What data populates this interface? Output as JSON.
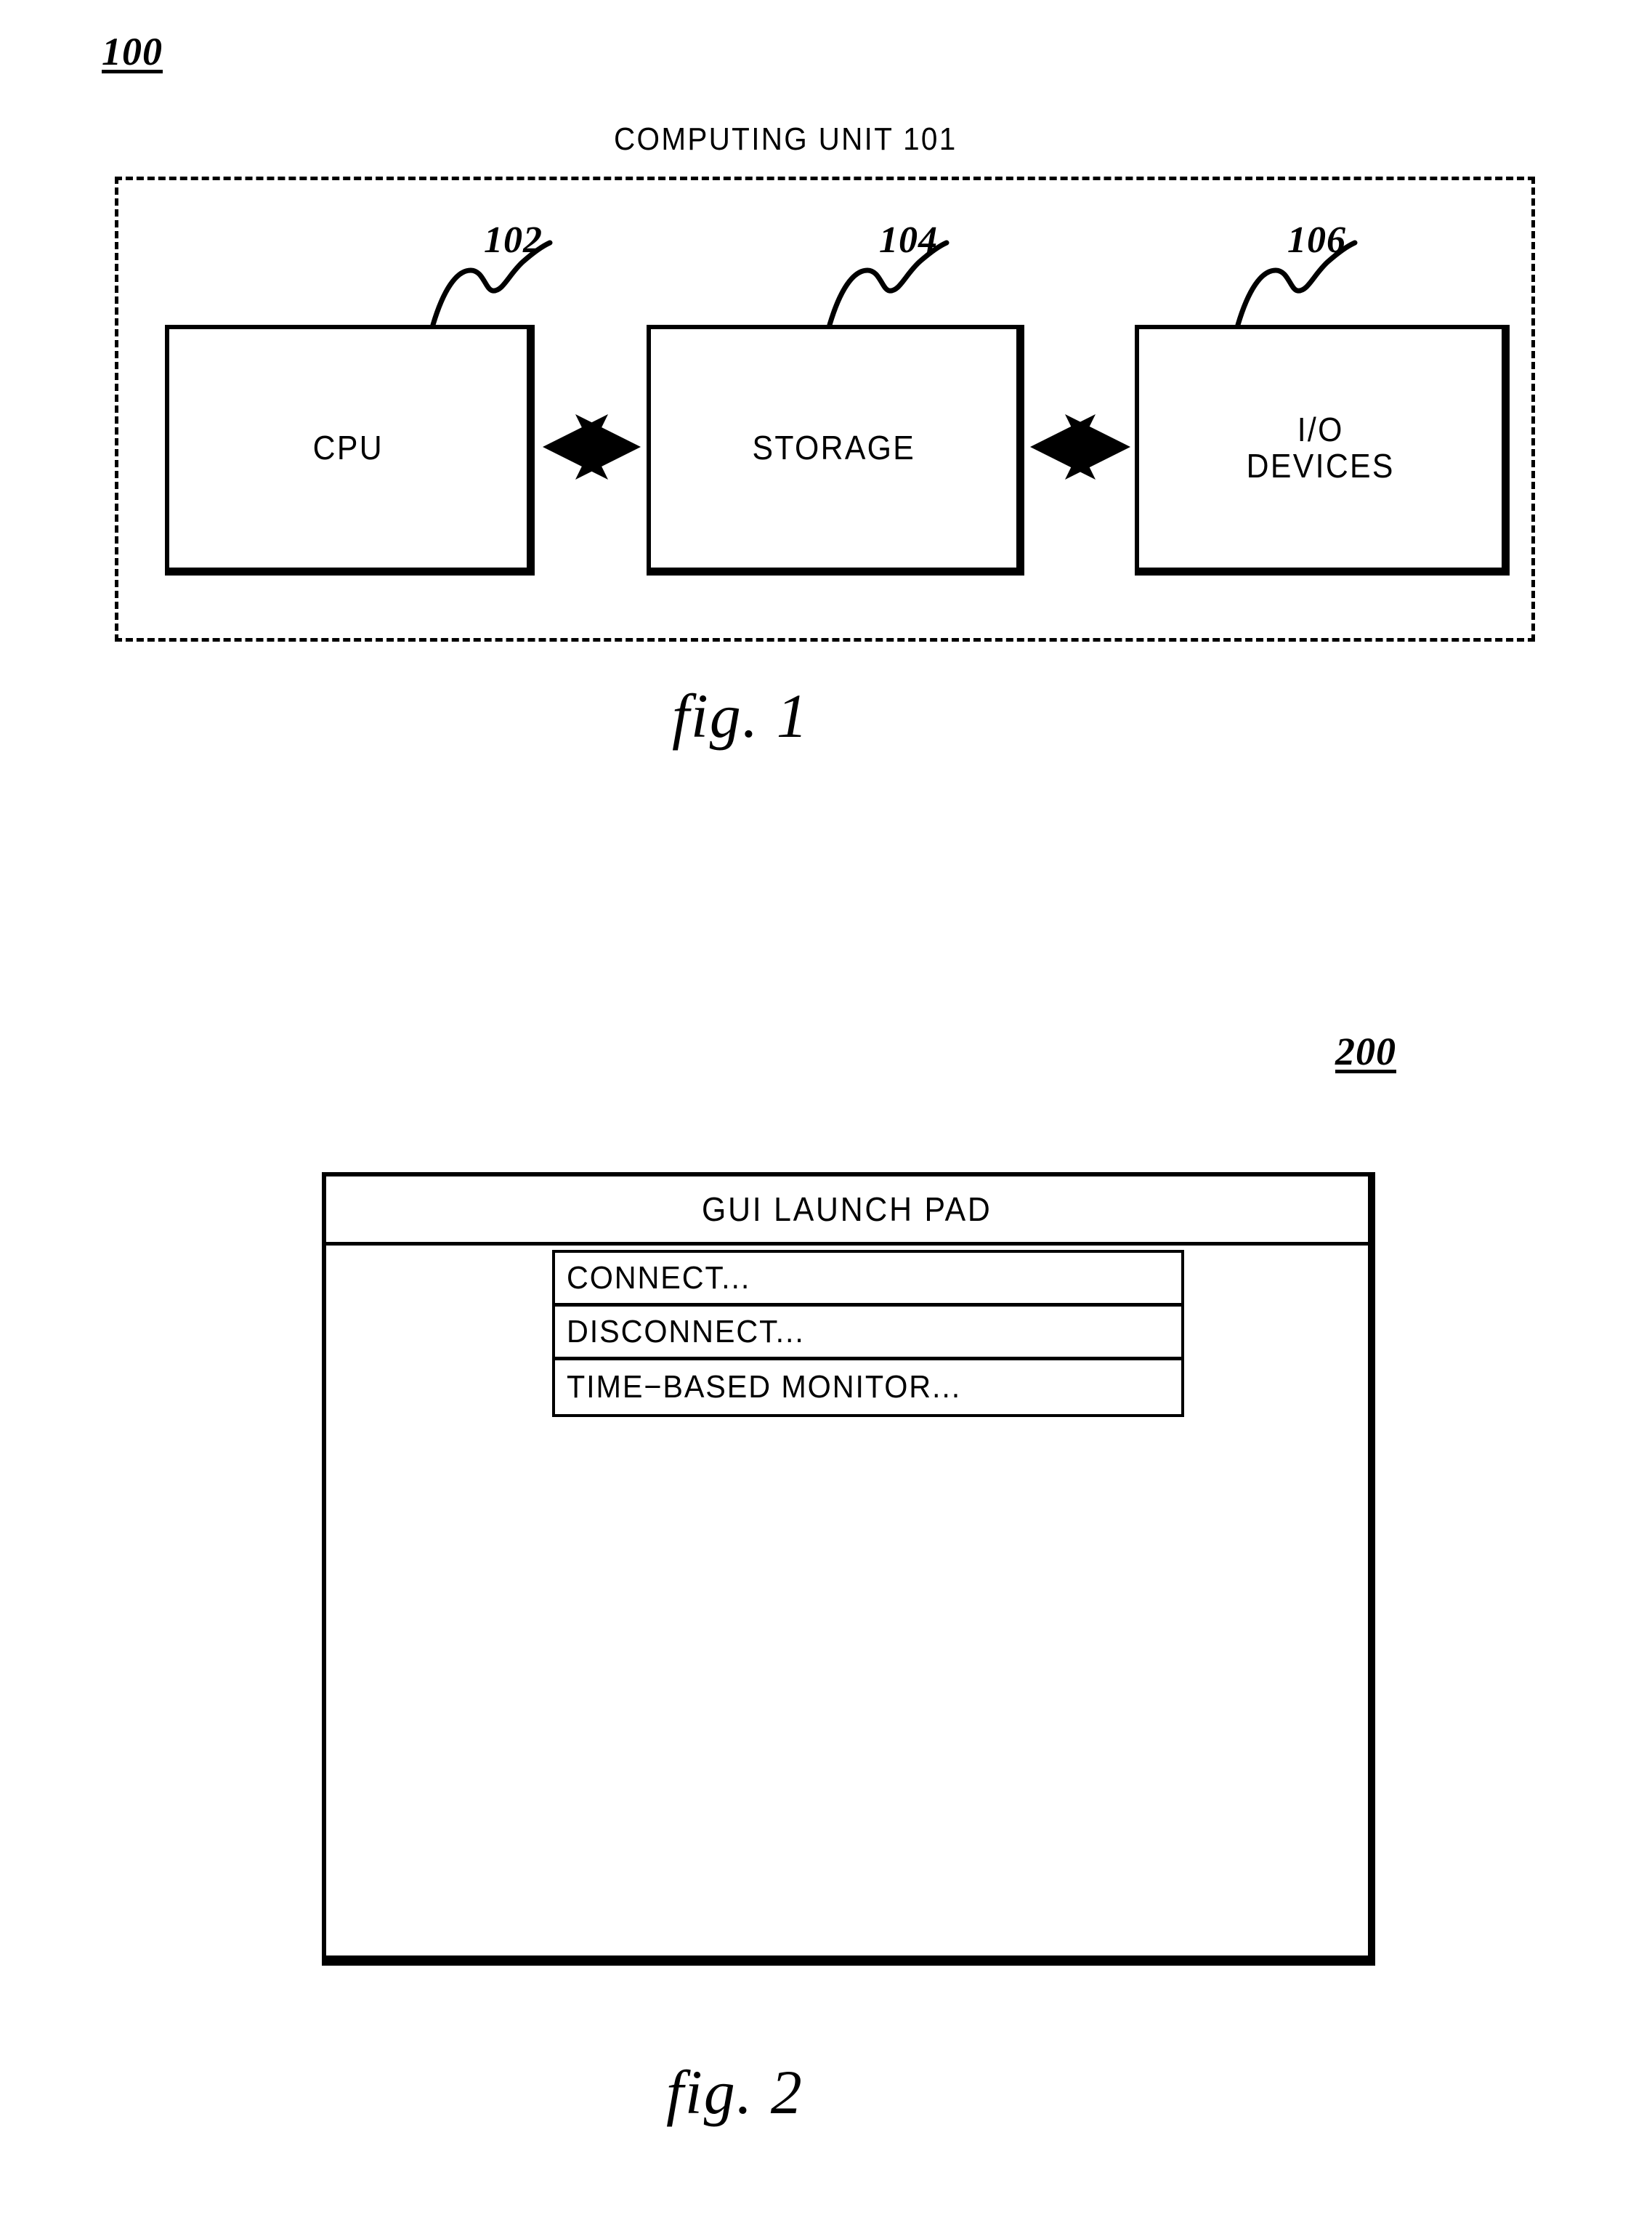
{
  "figures": [
    {
      "id": "fig1",
      "ref_number": "100",
      "caption": "fig.  1",
      "enclosure_label": "COMPUTING UNIT  101",
      "blocks": [
        {
          "label": "CPU",
          "ref": "102"
        },
        {
          "label": "STORAGE",
          "ref": "104"
        },
        {
          "label": "I/O\nDEVICES",
          "label_line1": "I/O",
          "label_line2": "DEVICES",
          "ref": "106"
        }
      ],
      "connectors": [
        {
          "from": "CPU",
          "to": "STORAGE",
          "style": "double-arrow"
        },
        {
          "from": "STORAGE",
          "to": "I/O DEVICES",
          "style": "double-arrow"
        }
      ]
    },
    {
      "id": "fig2",
      "ref_number": "200",
      "caption": "fig.  2",
      "window": {
        "title": "GUI LAUNCH PAD",
        "menu_items": [
          {
            "label": "CONNECT..."
          },
          {
            "label": "DISCONNECT..."
          },
          {
            "label": "TIME−BASED MONITOR..."
          }
        ]
      }
    }
  ],
  "colors": {
    "ink": "#000000",
    "paper": "#ffffff"
  }
}
